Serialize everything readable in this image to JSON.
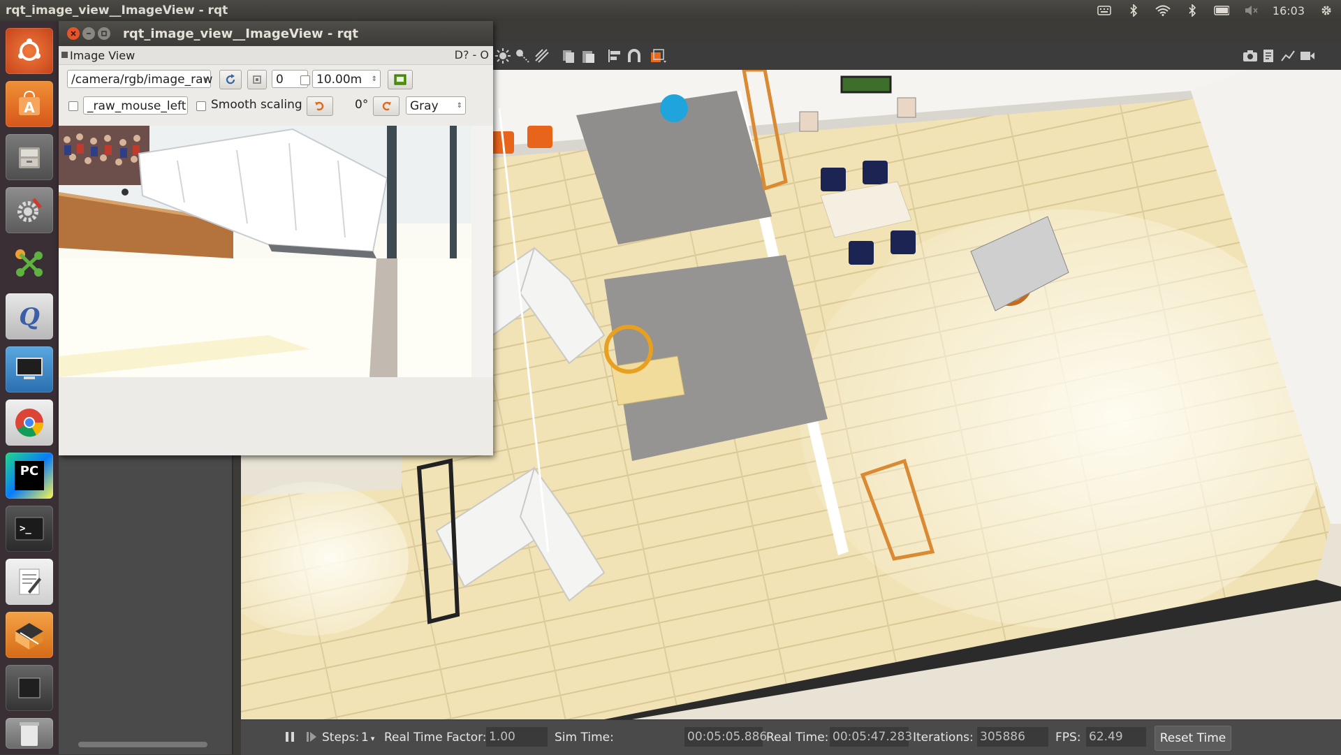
{
  "top_panel": {
    "window_title": "rqt_image_view__ImageView - rqt",
    "clock": "16:03"
  },
  "tray_icons": [
    "keyboard-icon",
    "bluetooth-icon",
    "wifi-icon",
    "bluetooth-icon",
    "battery-icon",
    "volume-icon",
    "gear-icon"
  ],
  "launcher": {
    "items": [
      {
        "name": "ubuntu-dash-icon",
        "color": "#e95420"
      },
      {
        "name": "software-center-icon",
        "color": "#e3701e"
      },
      {
        "name": "files-icon",
        "color": "#6d6d6d"
      },
      {
        "name": "system-settings-icon",
        "color": "#8a8a8a"
      },
      {
        "name": "gitkraken-icon",
        "color": "#5fb142"
      },
      {
        "name": "qtcreator-icon",
        "color": "#d0d0d0"
      },
      {
        "name": "remote-desktop-icon",
        "color": "#3a88c9"
      },
      {
        "name": "chrome-icon",
        "color": "#2f9d4a"
      },
      {
        "name": "pycharm-icon",
        "color": "#21d789"
      },
      {
        "name": "terminal-icon",
        "color": "#2b2b2b"
      },
      {
        "name": "text-editor-icon",
        "color": "#e6e6e6"
      },
      {
        "name": "gazebo-icon",
        "color": "#f08a24"
      },
      {
        "name": "workspace-switcher-icon",
        "color": "#444444"
      },
      {
        "name": "trash-icon",
        "color": "#9a9a9a"
      }
    ],
    "pycharm_label": "PC"
  },
  "rqt": {
    "title": "rqt_image_view__ImageView - rqt",
    "dock_title": "Image View",
    "dock_controls": "D?  - O",
    "topic": "/camera/rgb/image_raw",
    "refresh_icon": "refresh-icon",
    "zoom_icon": "zoom-icon",
    "spin_value": "0",
    "max_range": "10.00m",
    "save_icon": "save-icon",
    "mouse_topic": "_raw_mouse_left",
    "smooth_scaling": "Smooth scaling",
    "rotate_left_icon": "rotate-ccw-icon",
    "rotation": "0°",
    "rotate_right_icon": "rotate-cw-icon",
    "color_scheme": "Gray"
  },
  "gazebo": {
    "status": {
      "steps_label": "Steps:",
      "steps_value": "1",
      "rtf_label": "Real Time Factor:",
      "rtf_value": "1.00",
      "sim_time_label": "Sim Time:",
      "sim_time_value": "00:05:05.886",
      "real_time_label": "Real Time:",
      "real_time_value": "00:05:47.283",
      "iterations_label": "Iterations:",
      "iterations_value": "305886",
      "fps_label": "FPS:",
      "fps_value": "62.49",
      "reset_button": "Reset Time"
    },
    "toolbar_icons": [
      "sun-icon",
      "spot-light-icon",
      "directional-light-icon",
      "copy-icon",
      "paste-icon",
      "align-icon",
      "snap-icon",
      "record-icon",
      "screenshot-icon",
      "log-icon",
      "plot-icon",
      "video-icon"
    ]
  }
}
